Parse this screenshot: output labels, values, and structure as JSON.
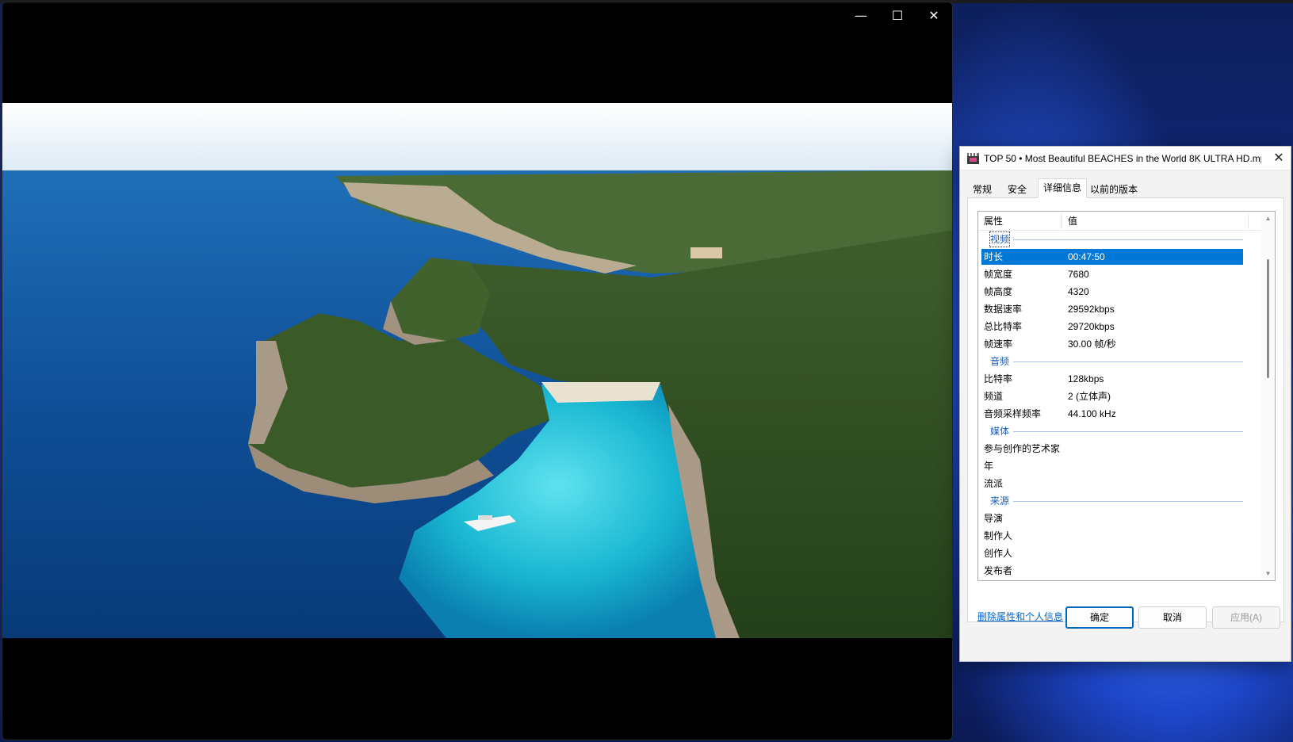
{
  "dialog": {
    "title": "TOP 50 • Most Beautiful BEACHES in the World 8K ULTRA HD.mp4...",
    "tabs": [
      {
        "label": "常规"
      },
      {
        "label": "安全"
      },
      {
        "label": "详细信息"
      },
      {
        "label": "以前的版本"
      }
    ],
    "active_tab": "详细信息",
    "headers": {
      "property": "属性",
      "value": "值"
    },
    "groups": {
      "video": "视频",
      "audio": "音频",
      "media": "媒体",
      "source": "来源"
    },
    "video_rows": [
      {
        "k": "时长",
        "v": "00:47:50"
      },
      {
        "k": "帧宽度",
        "v": "7680"
      },
      {
        "k": "帧高度",
        "v": "4320"
      },
      {
        "k": "数据速率",
        "v": "29592kbps"
      },
      {
        "k": "总比特率",
        "v": "29720kbps"
      },
      {
        "k": "帧速率",
        "v": "30.00 帧/秒"
      }
    ],
    "audio_rows": [
      {
        "k": "比特率",
        "v": "128kbps"
      },
      {
        "k": "频道",
        "v": "2 (立体声)"
      },
      {
        "k": "音频采样频率",
        "v": "44.100 kHz"
      }
    ],
    "media_rows": [
      {
        "k": "参与创作的艺术家",
        "v": ""
      },
      {
        "k": "年",
        "v": ""
      },
      {
        "k": "流派",
        "v": ""
      }
    ],
    "source_rows": [
      {
        "k": "导演",
        "v": ""
      },
      {
        "k": "制作人",
        "v": ""
      },
      {
        "k": "创作人",
        "v": ""
      },
      {
        "k": "发布者",
        "v": ""
      }
    ],
    "remove_link": "删除属性和个人信息",
    "buttons": {
      "ok": "确定",
      "cancel": "取消",
      "apply": "应用(A)"
    }
  },
  "player": {
    "controls": {
      "minimize": "—",
      "maximize": "☐",
      "close": "✕"
    }
  },
  "colors": {
    "selection": "#0078d7",
    "group_label": "#1a5ebd",
    "link": "#0066cc",
    "ok_border": "#0067c0"
  },
  "icons": [
    "film-icon",
    "close-icon",
    "minimize-icon",
    "maximize-icon",
    "scroll-up-icon",
    "scroll-down-icon"
  ]
}
